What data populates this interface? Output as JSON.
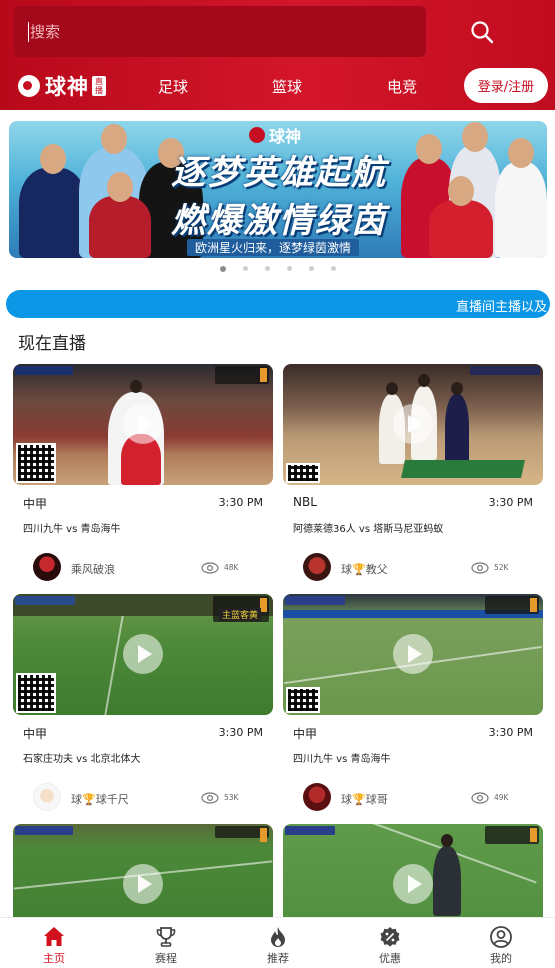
{
  "search": {
    "placeholder": "搜索"
  },
  "header": {
    "logo_text": "球神",
    "logo_badge": "直播",
    "nav": [
      "足球",
      "篮球",
      "电竞"
    ],
    "login_label": "登录/注册"
  },
  "banner": {
    "logo_text": "球神",
    "headline_1": "逐梦英雄起航",
    "headline_2": "燃爆激情绿茵",
    "subtitle": "欧洲星火归来，逐梦绿茵激情",
    "slides_total": 6,
    "active_slide": 1
  },
  "marquee": {
    "text": "直播间主播以及"
  },
  "section": {
    "title": "现在直播"
  },
  "cards": [
    {
      "league": "中甲",
      "time": "3:30 PM",
      "match": "四川九牛 vs 青岛海牛",
      "anchor": "乘风破浪",
      "views": "48K"
    },
    {
      "league": "NBL",
      "time": "3:30 PM",
      "match": "阿德莱德36人 vs 塔斯马尼亚蚂蚁",
      "anchor": "球🏆教父",
      "views": "52K"
    },
    {
      "league": "中甲",
      "time": "3:30 PM",
      "match": "石家庄功夫 vs 北京北体大",
      "anchor": "球🏆球千尺",
      "views": "53K"
    },
    {
      "league": "中甲",
      "time": "3:30 PM",
      "match": "四川九牛 vs 青岛海牛",
      "anchor": "球🏆球哥",
      "views": "49K"
    }
  ],
  "thumb_overlay": {
    "tag": "主蓝客黄"
  },
  "tabbar": {
    "items": [
      {
        "label": "主页",
        "icon": "home-icon",
        "active": true
      },
      {
        "label": "赛程",
        "icon": "trophy-icon",
        "active": false
      },
      {
        "label": "推荐",
        "icon": "flame-icon",
        "active": false
      },
      {
        "label": "优惠",
        "icon": "discount-icon",
        "active": false
      },
      {
        "label": "我的",
        "icon": "profile-icon",
        "active": false
      }
    ]
  },
  "colors": {
    "brand_red": "#d4162a",
    "marquee_blue": "#0c96e6",
    "active_tab": "#d2111f"
  }
}
